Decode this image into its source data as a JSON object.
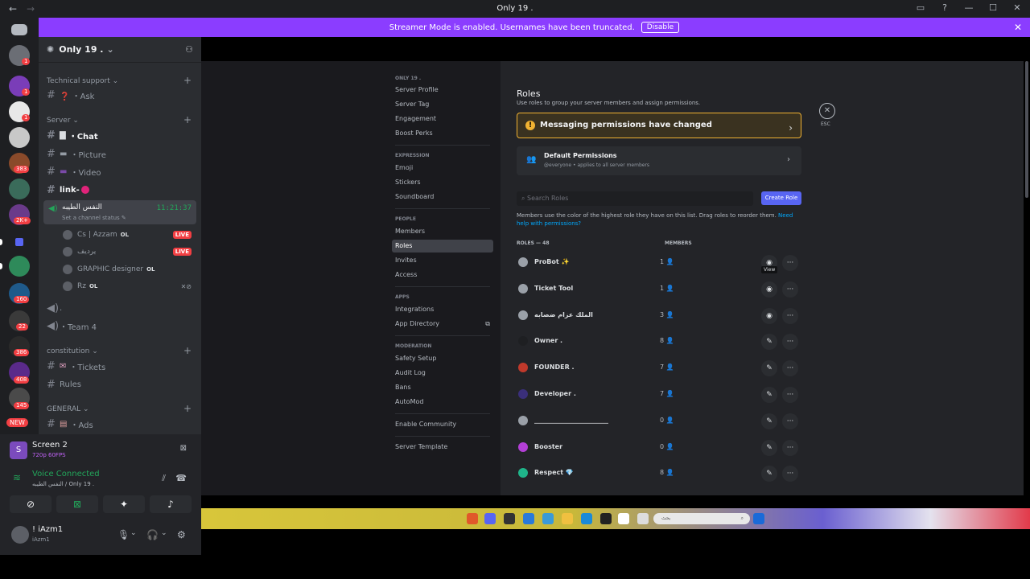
{
  "window": {
    "title": "Only 19 ."
  },
  "banner": {
    "text": "Streamer Mode is enabled. Usernames have been truncated.",
    "button": "Disable"
  },
  "rail": {
    "badges": [
      "1",
      "1",
      "1",
      "383",
      "2K+",
      "160",
      "22",
      "386",
      "408",
      "145",
      "NEW"
    ]
  },
  "server": {
    "name": "Only 19 ."
  },
  "categories": [
    "Technical support",
    "Server",
    "constitution",
    "GENERAL"
  ],
  "channels": {
    "ask": "❓ ・Ask",
    "chat": "・Chat",
    "picture": "・Picture",
    "video": "・Video",
    "link": "link-",
    "tickets": "・Tickets",
    "rules": "Rules",
    "ads": "・Ads"
  },
  "voice_channel": {
    "name": "النفس الطيبه",
    "time": "11:21:37",
    "status": "Set a channel status"
  },
  "voice_users": [
    {
      "name": "Cs | Azzam",
      "tag": "OL",
      "live": "LIVE"
    },
    {
      "name": "يرديف",
      "tag": "",
      "live": "LIVE"
    },
    {
      "name": "GRAPHIC designer",
      "tag": "OL",
      "live": ""
    },
    {
      "name": "Rz",
      "tag": "OL",
      "live": ""
    }
  ],
  "voice_channels": {
    "dot": ".",
    "team4": "・Team 4"
  },
  "panel": {
    "screen_title": "Screen 2",
    "screen_sub": "720p 60FPS",
    "voice_connected": "Voice Connected",
    "voice_path": "النفس الطيبه / Only 19 .",
    "username": "! iAzm1",
    "user_status": "iAzm1"
  },
  "settings_nav": {
    "server_header": "ONLY 19 .",
    "items_top": [
      "Server Profile",
      "Server Tag",
      "Engagement",
      "Boost Perks"
    ],
    "expression_header": "EXPRESSION",
    "items_expression": [
      "Emoji",
      "Stickers",
      "Soundboard"
    ],
    "people_header": "PEOPLE",
    "items_people": [
      "Members",
      "Roles",
      "Invites",
      "Access"
    ],
    "apps_header": "APPS",
    "items_apps": [
      "Integrations",
      "App Directory"
    ],
    "moderation_header": "MODERATION",
    "items_moderation": [
      "Safety Setup",
      "Audit Log",
      "Bans",
      "AutoMod"
    ],
    "community": "Enable Community",
    "template": "Server Template"
  },
  "roles": {
    "title": "Roles",
    "subtitle": "Use roles to group your server members and assign permissions.",
    "warning": "Messaging permissions have changed",
    "default_title": "Default Permissions",
    "default_sub": "@everyone • applies to all server members",
    "search_placeholder": "Search Roles",
    "create": "Create Role",
    "info": "Members use the color of the highest role they have on this list. Drag roles to reorder them.",
    "info_link": "Need help with permissions?",
    "col_roles": "ROLES — 48",
    "col_members": "MEMBERS",
    "esc": "ESC",
    "tooltip": "View",
    "list": [
      {
        "name": "ProBot ✨",
        "count": "1",
        "color": "#9aa0a8"
      },
      {
        "name": "Ticket Tool",
        "count": "1",
        "color": "#9aa0a8"
      },
      {
        "name": "الملك عزام ضصابه",
        "count": "3",
        "color": "#9aa0a8"
      },
      {
        "name": "Owner .",
        "count": "8",
        "color": "#1e1f22"
      },
      {
        "name": "FOUNDER .",
        "count": "7",
        "color": "#c0392b"
      },
      {
        "name": "Developer .",
        "count": "7",
        "color": "#3a2f7a"
      },
      {
        "name": "_______________________",
        "count": "0",
        "color": "#9aa0a8"
      },
      {
        "name": "Booster",
        "count": "0",
        "color": "#b33fd6"
      },
      {
        "name": "Respect 💎",
        "count": "8",
        "color": "#1fb58a"
      }
    ]
  },
  "taskbar": {
    "search": "بحث"
  }
}
